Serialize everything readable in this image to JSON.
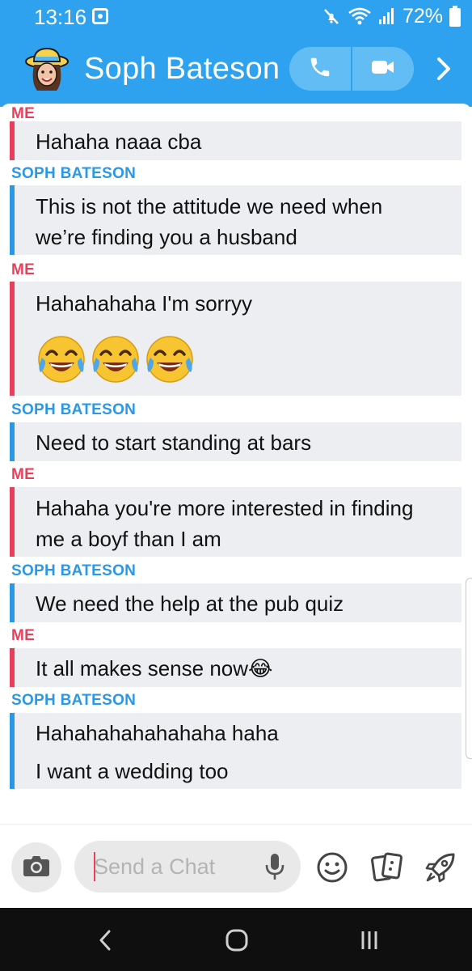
{
  "status_bar": {
    "time": "13:16",
    "battery": "72%",
    "icons": [
      "notification-icon",
      "mute-icon",
      "wifi-icon",
      "signal-icon",
      "battery-icon"
    ]
  },
  "header": {
    "title": "Soph Bateson",
    "accent_color": "#2ea2ef",
    "icons": [
      "avatar",
      "phone-icon",
      "video-icon",
      "chevron-right-icon"
    ]
  },
  "conversation": {
    "colors": {
      "me": "#e8405b",
      "them": "#2b98e6",
      "bubble": "#eceef1"
    },
    "messages": [
      {
        "sender": "ME",
        "lines": [
          "Hahaha naaa cba"
        ]
      },
      {
        "sender": "SOPH BATESON",
        "lines": [
          "This is not the attitude we need when",
          "we’re finding you a husband"
        ]
      },
      {
        "sender": "ME",
        "lines": [
          "Hahahahaha I'm sorryy"
        ],
        "emojis": [
          "😂",
          "😂",
          "😂"
        ]
      },
      {
        "sender": "SOPH BATESON",
        "lines": [
          "Need to start standing at bars"
        ]
      },
      {
        "sender": "ME",
        "lines": [
          "Hahaha you're more interested in finding",
          "me a boyf than I am"
        ]
      },
      {
        "sender": "SOPH BATESON",
        "lines": [
          "We need the help at the pub quiz"
        ]
      },
      {
        "sender": "ME",
        "lines": [
          "It all makes sense now😂"
        ]
      },
      {
        "sender": "SOPH BATESON",
        "lines": [
          "Hahahahahahahaha haha",
          "I want a wedding too"
        ]
      }
    ]
  },
  "input_bar": {
    "placeholder": "Send a Chat",
    "value": "",
    "icons": [
      "camera-icon",
      "mic-icon",
      "smiley-icon",
      "cards-icon",
      "rocket-icon"
    ]
  },
  "nav_bar": {
    "icons": [
      "back-icon",
      "home-icon",
      "recents-icon"
    ]
  }
}
